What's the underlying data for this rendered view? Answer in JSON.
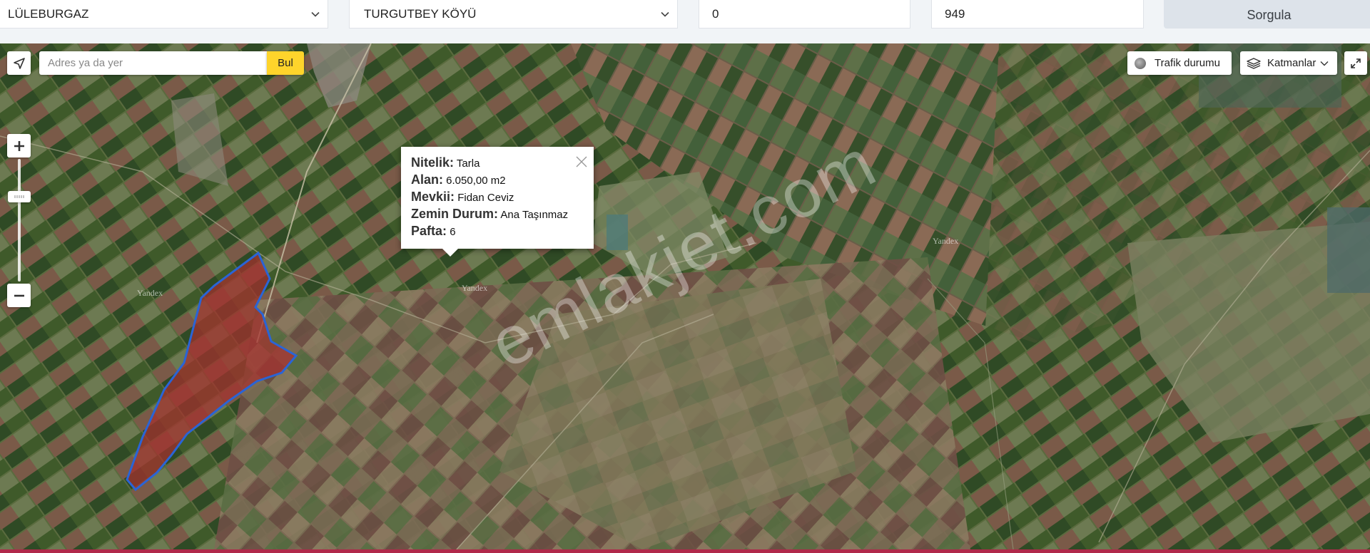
{
  "query": {
    "district": "LÜLEBURGAZ",
    "neighborhood": "TURGUTBEY KÖYÜ",
    "block": "0",
    "parcel": "949",
    "submit_label": "Sorgula"
  },
  "map_controls": {
    "search_placeholder": "Adres ya da yer",
    "find_label": "Bul",
    "traffic_label": "Trafik durumu",
    "layers_label": "Katmanlar"
  },
  "popup": {
    "rows": [
      {
        "key": "Nitelik:",
        "value": "Tarla"
      },
      {
        "key": "Alan:",
        "value": "6.050,00 m2"
      },
      {
        "key": "Mevkii:",
        "value": "Fidan Ceviz"
      },
      {
        "key": "Zemin Durum:",
        "value": "Ana Taşınmaz"
      },
      {
        "key": "Pafta:",
        "value": "6"
      }
    ]
  },
  "map": {
    "watermark": "emlakjet.com",
    "provider_labels": [
      "Yandex",
      "Yandex",
      "Yandex"
    ],
    "colors": {
      "village_fill": "#a5302e",
      "village_stroke": "#2a64d6",
      "parcel_fill": "#e9a23a",
      "accent_button": "#fed42b"
    }
  }
}
